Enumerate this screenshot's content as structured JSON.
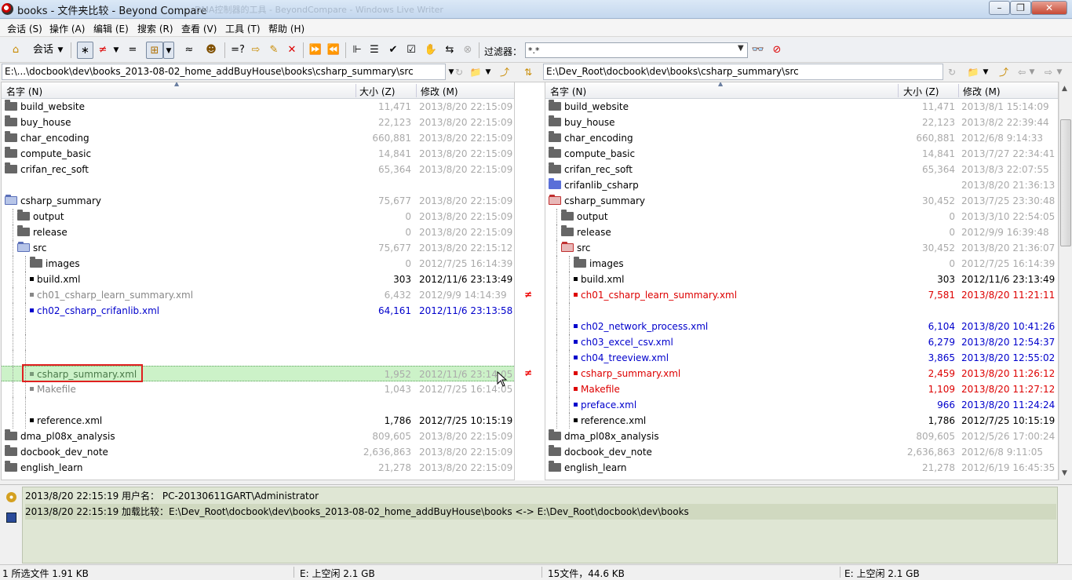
{
  "window": {
    "title": "books - 文件夹比较 - Beyond Compare",
    "background_title": "  DMA控制器的工具 - BeyondCompare - Windows Live Writer"
  },
  "menu": [
    "会话 (S)",
    "操作 (A)",
    "编辑 (E)",
    "搜索 (R)",
    "查看 (V)",
    "工具 (T)",
    "帮助 (H)"
  ],
  "toolbar": {
    "session_label": "会话",
    "filter_label": "过滤器：",
    "filter_value": "*.*"
  },
  "paths": {
    "left": "E:\\...\\docbook\\dev\\books_2013-08-02_home_addBuyHouse\\books\\csharp_summary\\src",
    "right": "E:\\Dev_Root\\docbook\\dev\\books\\csharp_summary\\src"
  },
  "columns": {
    "name": "名字 (N)",
    "size": "大小 (Z)",
    "modified": "修改 (M)"
  },
  "left_rows": [
    {
      "name": "build_website",
      "size": "11,471",
      "date": "2013/8/20 22:15:09",
      "kind": "folder",
      "level": 0,
      "style": "gray"
    },
    {
      "name": "buy_house",
      "size": "22,123",
      "date": "2013/8/20 22:15:09",
      "kind": "folder",
      "level": 0,
      "style": "gray"
    },
    {
      "name": "char_encoding",
      "size": "660,881",
      "date": "2013/8/20 22:15:09",
      "kind": "folder",
      "level": 0,
      "style": "gray"
    },
    {
      "name": "compute_basic",
      "size": "14,841",
      "date": "2013/8/20 22:15:09",
      "kind": "folder",
      "level": 0,
      "style": "gray"
    },
    {
      "name": "crifan_rec_soft",
      "size": "65,364",
      "date": "2013/8/20 22:15:09",
      "kind": "folder",
      "level": 0,
      "style": "gray"
    },
    {
      "name": "",
      "size": "",
      "date": "",
      "kind": "blank",
      "level": 0,
      "style": "gray"
    },
    {
      "name": "csharp_summary",
      "size": "75,677",
      "date": "2013/8/20 22:15:09",
      "kind": "folder-open",
      "level": 0,
      "style": "gray"
    },
    {
      "name": "output",
      "size": "0",
      "date": "2013/8/20 22:15:09",
      "kind": "folder",
      "level": 1,
      "style": "gray"
    },
    {
      "name": "release",
      "size": "0",
      "date": "2013/8/20 22:15:09",
      "kind": "folder",
      "level": 1,
      "style": "gray"
    },
    {
      "name": "src",
      "size": "75,677",
      "date": "2013/8/20 22:15:12",
      "kind": "folder-open",
      "level": 1,
      "style": "gray"
    },
    {
      "name": "images",
      "size": "0",
      "date": "2012/7/25 16:14:39",
      "kind": "folder",
      "level": 2,
      "style": "gray"
    },
    {
      "name": "build.xml",
      "size": "303",
      "date": "2012/11/6 23:13:49",
      "kind": "file",
      "level": 2,
      "style": "black"
    },
    {
      "name": "ch01_csharp_learn_summary.xml",
      "size": "6,432",
      "date": "2012/9/9 14:14:39",
      "kind": "file",
      "level": 2,
      "style": "graytext"
    },
    {
      "name": "ch02_csharp_crifanlib.xml",
      "size": "64,161",
      "date": "2012/11/6 23:13:58",
      "kind": "file",
      "level": 2,
      "style": "blue"
    },
    {
      "name": "",
      "size": "",
      "date": "",
      "kind": "blank",
      "level": 2,
      "style": "gray"
    },
    {
      "name": "",
      "size": "",
      "date": "",
      "kind": "blank",
      "level": 2,
      "style": "gray"
    },
    {
      "name": "",
      "size": "",
      "date": "",
      "kind": "blank",
      "level": 2,
      "style": "gray"
    },
    {
      "name": "csharp_summary.xml",
      "size": "1,952",
      "date": "2012/11/6 23:14:05",
      "kind": "file",
      "level": 2,
      "style": "selected"
    },
    {
      "name": "Makefile",
      "size": "1,043",
      "date": "2012/7/25 16:14:05",
      "kind": "file",
      "level": 2,
      "style": "graytext"
    },
    {
      "name": "",
      "size": "",
      "date": "",
      "kind": "blank",
      "level": 2,
      "style": "gray"
    },
    {
      "name": "reference.xml",
      "size": "1,786",
      "date": "2012/7/25 10:15:19",
      "kind": "file",
      "level": 2,
      "style": "black"
    },
    {
      "name": "dma_pl08x_analysis",
      "size": "809,605",
      "date": "2013/8/20 22:15:09",
      "kind": "folder",
      "level": 0,
      "style": "gray"
    },
    {
      "name": "docbook_dev_note",
      "size": "2,636,863",
      "date": "2013/8/20 22:15:09",
      "kind": "folder",
      "level": 0,
      "style": "gray"
    },
    {
      "name": "english_learn",
      "size": "21,278",
      "date": "2013/8/20 22:15:09",
      "kind": "folder",
      "level": 0,
      "style": "gray"
    }
  ],
  "right_rows": [
    {
      "name": "build_website",
      "size": "11,471",
      "date": "2013/8/1 15:14:09",
      "kind": "folder",
      "level": 0,
      "style": "gray"
    },
    {
      "name": "buy_house",
      "size": "22,123",
      "date": "2013/8/2 22:39:44",
      "kind": "folder",
      "level": 0,
      "style": "gray"
    },
    {
      "name": "char_encoding",
      "size": "660,881",
      "date": "2012/6/8 9:14:33",
      "kind": "folder",
      "level": 0,
      "style": "gray"
    },
    {
      "name": "compute_basic",
      "size": "14,841",
      "date": "2013/7/27 22:34:41",
      "kind": "folder",
      "level": 0,
      "style": "gray"
    },
    {
      "name": "crifan_rec_soft",
      "size": "65,364",
      "date": "2013/8/3 22:07:55",
      "kind": "folder",
      "level": 0,
      "style": "gray"
    },
    {
      "name": "crifanlib_csharp",
      "size": "",
      "date": "2013/8/20 21:36:13",
      "kind": "folder-blue",
      "level": 0,
      "style": "gray"
    },
    {
      "name": "csharp_summary",
      "size": "30,452",
      "date": "2013/7/25 23:30:48",
      "kind": "folder-open-red",
      "level": 0,
      "style": "gray"
    },
    {
      "name": "output",
      "size": "0",
      "date": "2013/3/10 22:54:05",
      "kind": "folder",
      "level": 1,
      "style": "gray"
    },
    {
      "name": "release",
      "size": "0",
      "date": "2012/9/9 16:39:48",
      "kind": "folder",
      "level": 1,
      "style": "gray"
    },
    {
      "name": "src",
      "size": "30,452",
      "date": "2013/8/20 21:36:07",
      "kind": "folder-open-red",
      "level": 1,
      "style": "gray"
    },
    {
      "name": "images",
      "size": "0",
      "date": "2012/7/25 16:14:39",
      "kind": "folder",
      "level": 2,
      "style": "gray"
    },
    {
      "name": "build.xml",
      "size": "303",
      "date": "2012/11/6 23:13:49",
      "kind": "file",
      "level": 2,
      "style": "black"
    },
    {
      "name": "ch01_csharp_learn_summary.xml",
      "size": "7,581",
      "date": "2013/8/20 11:21:11",
      "kind": "file",
      "level": 2,
      "style": "red"
    },
    {
      "name": "",
      "size": "",
      "date": "",
      "kind": "blank",
      "level": 2,
      "style": "gray"
    },
    {
      "name": "ch02_network_process.xml",
      "size": "6,104",
      "date": "2013/8/20 10:41:26",
      "kind": "file",
      "level": 2,
      "style": "blue"
    },
    {
      "name": "ch03_excel_csv.xml",
      "size": "6,279",
      "date": "2013/8/20 12:54:37",
      "kind": "file",
      "level": 2,
      "style": "blue"
    },
    {
      "name": "ch04_treeview.xml",
      "size": "3,865",
      "date": "2013/8/20 12:55:02",
      "kind": "file",
      "level": 2,
      "style": "blue"
    },
    {
      "name": "csharp_summary.xml",
      "size": "2,459",
      "date": "2013/8/20 11:26:12",
      "kind": "file",
      "level": 2,
      "style": "red"
    },
    {
      "name": "Makefile",
      "size": "1,109",
      "date": "2013/8/20 11:27:12",
      "kind": "file",
      "level": 2,
      "style": "red"
    },
    {
      "name": "preface.xml",
      "size": "966",
      "date": "2013/8/20 11:24:24",
      "kind": "file",
      "level": 2,
      "style": "blue"
    },
    {
      "name": "reference.xml",
      "size": "1,786",
      "date": "2012/7/25 10:15:19",
      "kind": "file",
      "level": 2,
      "style": "black"
    },
    {
      "name": "dma_pl08x_analysis",
      "size": "809,605",
      "date": "2012/5/26 17:00:24",
      "kind": "folder",
      "level": 0,
      "style": "gray"
    },
    {
      "name": "docbook_dev_note",
      "size": "2,636,863",
      "date": "2012/6/8 9:11:05",
      "kind": "folder",
      "level": 0,
      "style": "gray"
    },
    {
      "name": "english_learn",
      "size": "21,278",
      "date": "2012/6/19 16:45:35",
      "kind": "folder",
      "level": 0,
      "style": "gray"
    }
  ],
  "diff_marker": "≠",
  "log": [
    "2013/8/20 22:15:19   用户名：  PC-20130611GART\\Administrator",
    "2013/8/20 22:15:19   加载比较：E:\\Dev_Root\\docbook\\dev\\books_2013-08-02_home_addBuyHouse\\books <-> E:\\Dev_Root\\docbook\\dev\\books"
  ],
  "status": {
    "left_selection": "1 所选文件 1.91 KB",
    "left_space": "E: 上空闲 2.1 GB",
    "right_files": "15文件，44.6 KB",
    "right_space": "E: 上空闲 2.1 GB"
  },
  "colors": {
    "diff_red": "#dd0000",
    "orphan_blue": "#0000cc",
    "selection_green": "#ccf2c8",
    "highlight_box": "#e02020",
    "log_background": "#dfe6d4"
  }
}
